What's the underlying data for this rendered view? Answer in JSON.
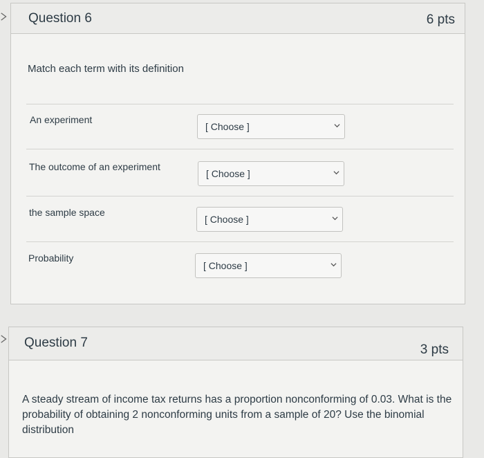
{
  "question6": {
    "title": "Question 6",
    "points": "6 pts",
    "prompt": "Match each term with its definition",
    "rows": [
      {
        "term": "An experiment",
        "select_value": "[ Choose ]"
      },
      {
        "term": "The outcome of an experiment",
        "select_value": "[ Choose ]"
      },
      {
        "term": "the sample space",
        "select_value": "[ Choose ]"
      },
      {
        "term": "Probability",
        "select_value": "[ Choose ]"
      }
    ]
  },
  "question7": {
    "title": "Question 7",
    "points": "3 pts",
    "text": "A steady stream of income tax returns has a proportion nonconforming of 0.03. What is the probability of obtaining 2 nonconforming units from a sample of 20? Use the binomial distribution"
  },
  "icons": {
    "collapse_marker": "chevron-right-icon",
    "dropdown": "chevron-down-icon"
  },
  "colors": {
    "page_bg": "#e9e9e7",
    "card_bg": "#f3f3f1",
    "header_bg": "#ececea",
    "text": "#2d3b45"
  }
}
